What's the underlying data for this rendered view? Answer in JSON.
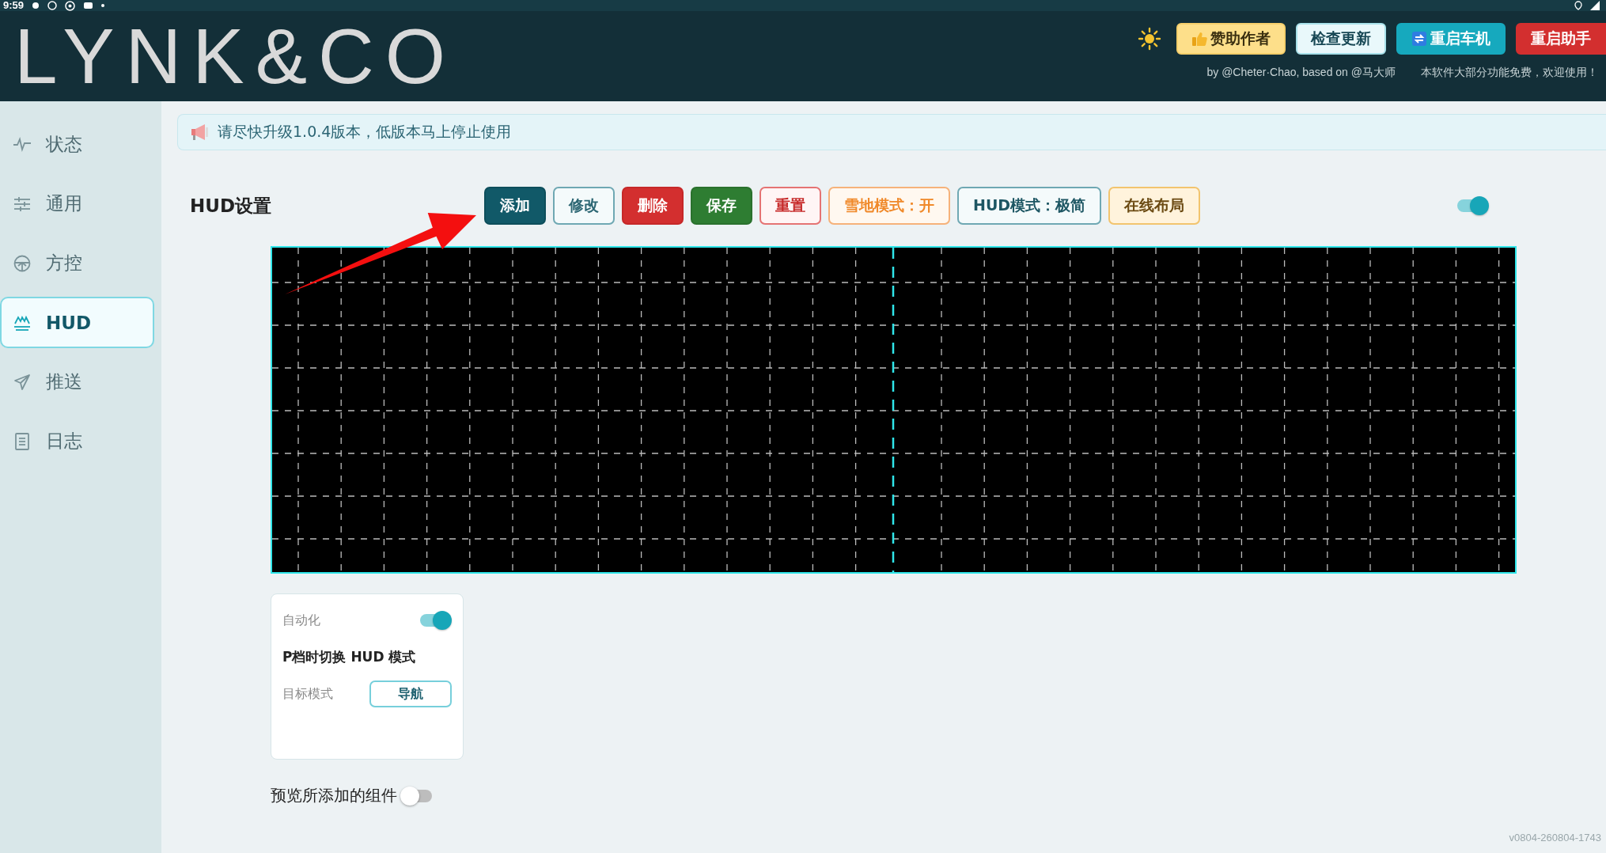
{
  "status_bar": {
    "time": "9:59"
  },
  "header": {
    "logo": "LYNK&CO",
    "buttons": [
      {
        "label": "赞助作者",
        "kind": "sponsor"
      },
      {
        "label": "检查更新",
        "kind": "light"
      },
      {
        "label": "重启车机",
        "kind": "teal"
      },
      {
        "label": "重启助手",
        "kind": "red"
      }
    ],
    "credits": "by @Cheter·Chao, based on @马大师",
    "tagline": "本软件大部分功能免费，欢迎使用！"
  },
  "sidebar": {
    "items": [
      {
        "label": "状态",
        "selected": false
      },
      {
        "label": "通用",
        "selected": false
      },
      {
        "label": "方控",
        "selected": false
      },
      {
        "label": "HUD",
        "selected": true
      },
      {
        "label": "推送",
        "selected": false
      },
      {
        "label": "日志",
        "selected": false
      }
    ]
  },
  "notice": "请尽快升级1.0.4版本，低版本马上停止使用",
  "hud": {
    "title": "HUD设置",
    "buttons": [
      {
        "label": "添加",
        "kind": "primary"
      },
      {
        "label": "修改",
        "kind": "outline"
      },
      {
        "label": "删除",
        "kind": "danger"
      },
      {
        "label": "保存",
        "kind": "success"
      },
      {
        "label": "重置",
        "kind": "danger-outline"
      },
      {
        "label": "雪地模式：开",
        "kind": "warning-outline"
      },
      {
        "label": "HUD模式：极简",
        "kind": "info-outline"
      },
      {
        "label": "在线布局",
        "kind": "warning"
      }
    ],
    "toggle": {
      "on": true
    }
  },
  "automation": {
    "label": "自动化",
    "on": true,
    "title": "P档时切换 HUD 模式",
    "field_label": "目标模式",
    "value": "导航"
  },
  "preview": {
    "label": "预览所添加的组件",
    "on": false
  },
  "version": "v0804-260804-1743"
}
